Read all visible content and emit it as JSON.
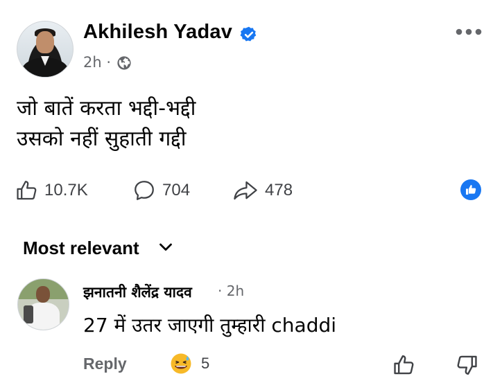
{
  "post": {
    "author": "Akhilesh Yadav",
    "time": "2h",
    "separator": "·",
    "audience_icon": "globe-icon",
    "verified_icon": "verified-badge-icon",
    "lines": [
      "जो बातें करता भद्दी-भद्दी",
      "उसको नहीं सुहाती गद्दी"
    ]
  },
  "actions": {
    "likes": "10.7K",
    "comments": "704",
    "shares": "478"
  },
  "sort": {
    "label": "Most relevant"
  },
  "comment": {
    "author": "झनातनी शैलेंद्र यादव",
    "time": "· 2h",
    "text": "27 में उतर जाएगी तुम्हारी chaddi",
    "reply_label": "Reply",
    "reaction_count": "5",
    "reaction_icon": "grinning-sweat-emoji-icon"
  },
  "colors": {
    "accent": "#1877f2",
    "secondary_text": "#65676b",
    "primary_text": "#050505"
  }
}
